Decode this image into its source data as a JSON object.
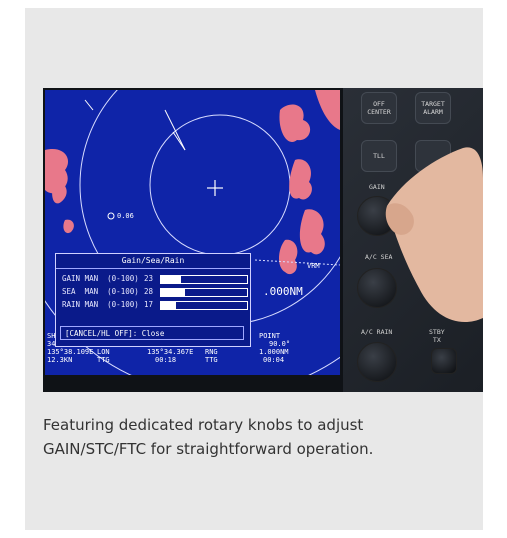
{
  "dialog": {
    "title": "Gain/Sea/Rain",
    "rows": [
      {
        "label": "GAIN MAN  (0-100)",
        "value": "23",
        "level": 0.23
      },
      {
        "label": "SEA  MAN  (0-100)",
        "value": "28",
        "level": 0.28
      },
      {
        "label": "RAIN MAN  (0-100)",
        "value": "17",
        "level": 0.17
      }
    ],
    "footer": "[CANCEL/HL OFF]: Close"
  },
  "screen": {
    "range_ring_label": "0.06",
    "vrm_label": "VRM",
    "point_label": "POINT",
    "point_distance": ".000NM",
    "left_labels": [
      "SH",
      "34"
    ],
    "lat_lon": "135°38.109E",
    "lon_label": "LON",
    "lon_value": "135°34.367E",
    "rng_label": "RNG",
    "bearing_value": "90.0°",
    "rng_value": "1.000NM",
    "dist_value": "12.3KN",
    "ttg_label_1": "TTG",
    "ttg_value_1": "00:18",
    "ttg_label_2": "TTG",
    "ttg_value_2": "00:04"
  },
  "panel": {
    "btn_off_center": "OFF\nCENTER",
    "btn_target_alarm": "TARGET\nALARM",
    "btn_tll": "TLL",
    "label_gain": "GAIN",
    "label_ac_sea": "A/C SEA",
    "label_ac_rain": "A/C RAIN",
    "label_stby_tx": "STBY\nTX"
  },
  "caption": {
    "line1": "Featuring dedicated rotary knobs to adjust",
    "line2": "GAIN/STC/FTC for straightforward operation."
  },
  "colors": {
    "screen_bg": "#0f24a8",
    "echo": "#e8788a",
    "card_bg": "#e8e8e8"
  }
}
